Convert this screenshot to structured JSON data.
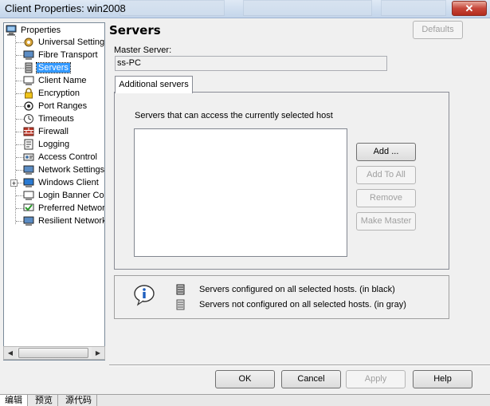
{
  "window": {
    "title": "Client Properties: win2008",
    "close_label": "✕"
  },
  "tree": {
    "root": "Properties",
    "items": [
      {
        "label": "Universal Settings",
        "icon": "universal-settings-icon"
      },
      {
        "label": "Fibre Transport",
        "icon": "fibre-transport-icon"
      },
      {
        "label": "Servers",
        "icon": "servers-icon",
        "selected": true
      },
      {
        "label": "Client Name",
        "icon": "client-name-icon"
      },
      {
        "label": "Encryption",
        "icon": "encryption-icon"
      },
      {
        "label": "Port Ranges",
        "icon": "port-ranges-icon"
      },
      {
        "label": "Timeouts",
        "icon": "timeouts-icon"
      },
      {
        "label": "Firewall",
        "icon": "firewall-icon"
      },
      {
        "label": "Logging",
        "icon": "logging-icon"
      },
      {
        "label": "Access Control",
        "icon": "access-control-icon"
      },
      {
        "label": "Network Settings",
        "icon": "network-settings-icon"
      },
      {
        "label": "Windows Client",
        "icon": "windows-client-icon",
        "expander": "+"
      },
      {
        "label": "Login Banner Conf",
        "icon": "login-banner-icon"
      },
      {
        "label": "Preferred Network",
        "icon": "preferred-network-icon"
      },
      {
        "label": "Resilient Network",
        "icon": "resilient-network-icon"
      }
    ]
  },
  "page": {
    "heading": "Servers",
    "defaults_label": "Defaults",
    "master_server_label": "Master Server:",
    "master_server_value": "ss-PC",
    "tab_label": "Additional servers",
    "list_caption": "Servers that can access the currently selected host",
    "buttons": {
      "add": "Add ...",
      "add_to_all": "Add To All",
      "remove": "Remove",
      "make_master": "Make Master"
    }
  },
  "legend": {
    "configured": "Servers configured on all selected hosts. (in black)",
    "not_configured": "Servers not configured on all selected hosts. (in gray)"
  },
  "footer": {
    "ok": "OK",
    "cancel": "Cancel",
    "apply": "Apply",
    "help": "Help"
  },
  "bottom_tabs": [
    "编辑",
    "预览",
    "源代码"
  ]
}
